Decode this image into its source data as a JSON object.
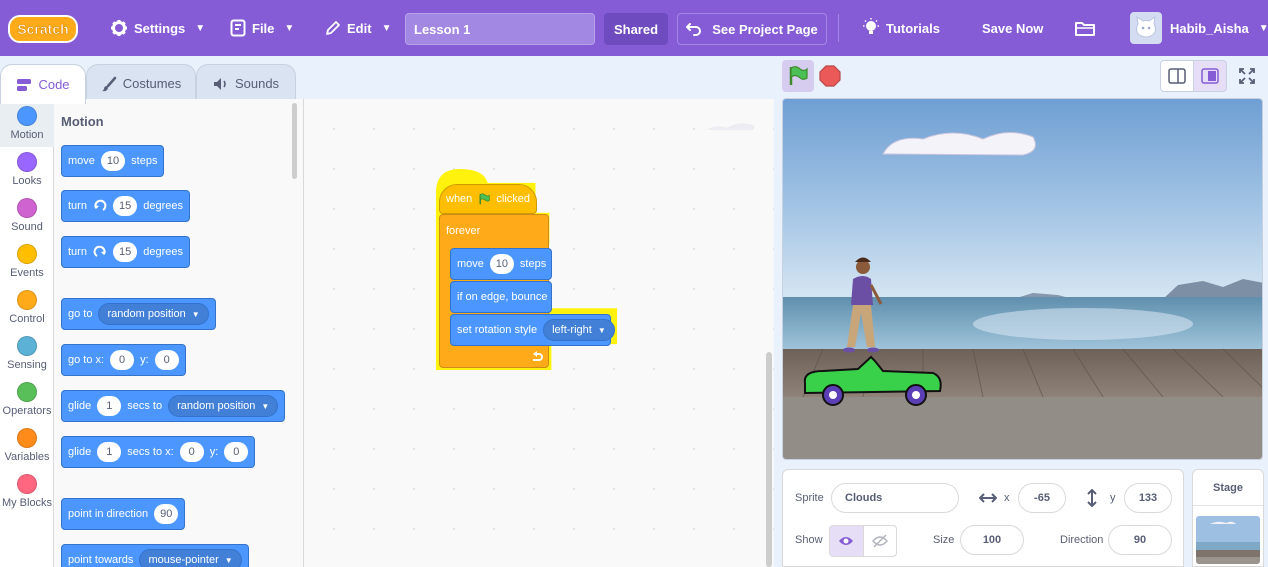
{
  "menu": {
    "logo_text": "Scratch",
    "settings": "Settings",
    "file": "File",
    "edit": "Edit",
    "project_title": "Lesson 1",
    "shared": "Shared",
    "see_project_page": "See Project Page",
    "tutorials": "Tutorials",
    "save_now": "Save Now",
    "username": "Habib_Aisha"
  },
  "tabs": {
    "code": "Code",
    "costumes": "Costumes",
    "sounds": "Sounds"
  },
  "categories": [
    {
      "label": "Motion",
      "color": "#4c97ff"
    },
    {
      "label": "Looks",
      "color": "#9966ff"
    },
    {
      "label": "Sound",
      "color": "#cf63cf"
    },
    {
      "label": "Events",
      "color": "#ffbf00"
    },
    {
      "label": "Control",
      "color": "#ffab19"
    },
    {
      "label": "Sensing",
      "color": "#5cb1d6"
    },
    {
      "label": "Operators",
      "color": "#59c059"
    },
    {
      "label": "Variables",
      "color": "#ff8c1a"
    },
    {
      "label": "My Blocks",
      "color": "#ff6680"
    }
  ],
  "palette": {
    "title": "Motion",
    "move": {
      "a": "move",
      "n": "10",
      "b": "steps"
    },
    "turn_cw": {
      "a": "turn",
      "n": "15",
      "b": "degrees"
    },
    "turn_ccw": {
      "a": "turn",
      "n": "15",
      "b": "degrees"
    },
    "goto": {
      "a": "go to",
      "dd": "random position"
    },
    "goto_xy": {
      "a": "go to x:",
      "x": "0",
      "b": "y:",
      "y": "0"
    },
    "glide": {
      "a": "glide",
      "n": "1",
      "b": "secs to",
      "dd": "random position"
    },
    "glide_xy": {
      "a": "glide",
      "n": "1",
      "b": "secs to x:",
      "x": "0",
      "c": "y:",
      "y": "0"
    },
    "point_dir": {
      "a": "point in direction",
      "n": "90"
    },
    "point_towards": {
      "a": "point towards",
      "dd": "mouse-pointer"
    }
  },
  "script": {
    "when": "when",
    "clicked": "clicked",
    "forever": "forever",
    "move": "move",
    "move_n": "10",
    "steps": "steps",
    "bounce": "if on edge, bounce",
    "rotation": "set rotation style",
    "rotation_dd": "left-right"
  },
  "sprite": {
    "label": "Sprite",
    "name": "Clouds",
    "x_label": "x",
    "x": "-65",
    "y_label": "y",
    "y": "133",
    "show_label": "Show",
    "size_label": "Size",
    "size": "100",
    "direction_label": "Direction",
    "direction": "90"
  },
  "stage_pane": {
    "title": "Stage"
  },
  "colors": {
    "accent": "#855cd6",
    "motion": "#4c97ff",
    "events": "#ffbf00",
    "control": "#ffab19"
  }
}
